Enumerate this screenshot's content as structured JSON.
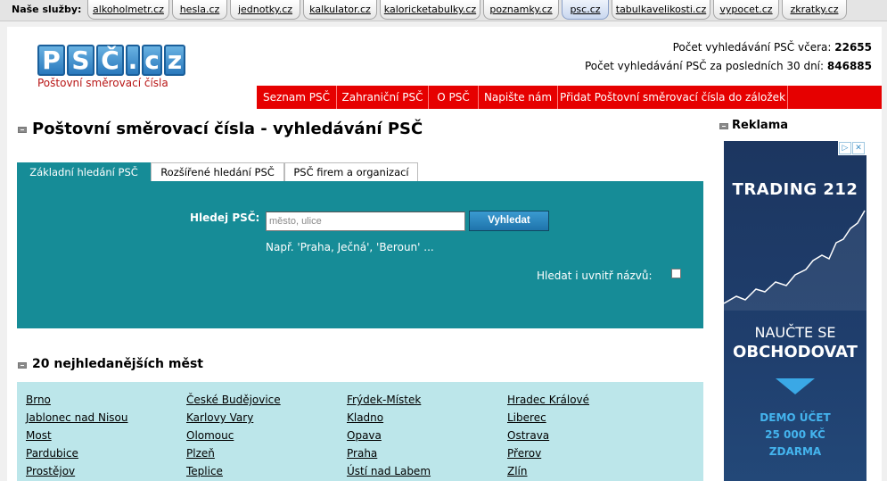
{
  "services": {
    "label": "Naše služby:",
    "tabs": [
      "alkoholmetr.cz",
      "hesla.cz",
      "jednotky.cz",
      "kalkulator.cz",
      "kaloricketabulky.cz",
      "poznamky.cz",
      "psc.cz",
      "tabulkavelikosti.cz",
      "vypocet.cz",
      "zkratky.cz"
    ],
    "active": "psc.cz"
  },
  "logo": {
    "letters": [
      "P",
      "S",
      "Č",
      ".",
      "c",
      "z"
    ],
    "subtitle": "Poštovní směrovací čísla"
  },
  "stats": {
    "yesterday_label": "Počet vyhledávání PSČ včera:",
    "yesterday_value": "22655",
    "month_label": "Počet vyhledávání PSČ za posledních 30 dní:",
    "month_value": "846885"
  },
  "menu": [
    "Seznam PSČ",
    "Zahraniční PSČ",
    "O PSČ",
    "Napište nám",
    "Přidat Poštovní směrovací čísla do záložek"
  ],
  "main": {
    "title": "Poštovní směrovací čísla - vyhledávání PSČ",
    "tabs": [
      "Základní hledání PSČ",
      "Rozšířené hledání PSČ",
      "PSČ firem a organizací"
    ],
    "search_label": "Hledej PSČ:",
    "search_placeholder": "město, ulice",
    "search_button": "Vyhledat",
    "example": "Např. 'Praha, Ječná', 'Beroun' ...",
    "inside_label": "Hledat i uvnitř názvů:"
  },
  "cities": {
    "title": "20 nejhledanějších měst",
    "items": [
      "Brno",
      "České Budějovice",
      "Frýdek-Místek",
      "Hradec Králové",
      "Jablonec nad Nisou",
      "Karlovy Vary",
      "Kladno",
      "Liberec",
      "Most",
      "Olomouc",
      "Opava",
      "Ostrava",
      "Pardubice",
      "Plzeň",
      "Praha",
      "Přerov",
      "Prostějov",
      "Teplice",
      "Ústí nad Labem",
      "Zlín"
    ]
  },
  "sidebar": {
    "title": "Reklama",
    "ad": {
      "logo": "TRADING 212",
      "line1": "NAUČTE SE",
      "line2": "OBCHODOVAT",
      "line3": "DEMO ÚČET",
      "line4": "25 000 KČ",
      "line5": "ZDARMA"
    }
  },
  "colors": {
    "menu_red": "#e60000",
    "search_teal": "#168c97",
    "cities_bg": "#bce6ea",
    "logo_blue": "#2a79bd"
  }
}
